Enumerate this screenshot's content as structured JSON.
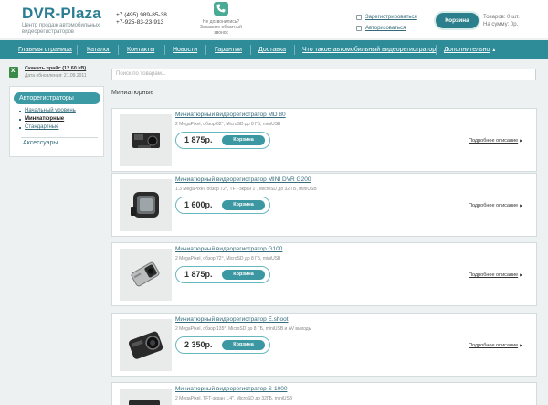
{
  "header": {
    "logo_dvr": "DVR",
    "logo_dash": "-",
    "logo_plaza": "Plaza",
    "logo_sub": "Центр продаж автомобильных видеорегистраторов",
    "phone1": "+7 (495) 989-85-38",
    "phone2": "+7-925-83-23-913",
    "callback_text": "Не дозвонились? Закажите обратный звонок",
    "register_link": "Зарегистрироваться",
    "login_link": "Авторизоваться",
    "cart_label": "Корзина",
    "cart_goods": "Товаров: 0 шт.",
    "cart_sum": "На сумму: 0р."
  },
  "nav": {
    "items": [
      "Главная страница",
      "Каталог",
      "Контакты",
      "Новости",
      "Гарантии",
      "Доставка",
      "Что такое автомобильный видеорегистратор",
      "Дополнительно"
    ]
  },
  "sidebar": {
    "download_label": "Скачать прайс",
    "download_size": "(12.60 kB)",
    "download_date": "Дата обновления: 21.09.2011",
    "active_item": "Авторегистраторы",
    "sub_items": [
      "Начальный уровень",
      "Миниатюрные",
      "Стандартные"
    ],
    "accessories": "Аксессуары"
  },
  "search": {
    "placeholder": "Поиск по товарам..."
  },
  "category_title": "Миниатюрные",
  "card_cart_label": "Корзина",
  "more_label": "Подробное описание",
  "products": [
    {
      "title": "Миниатюрный видеорегистратор MD 80",
      "desc": "2 MegaPixel, обзор 62°, MicroSD до 8 ГБ, miniUSB",
      "price": "1 875р."
    },
    {
      "title": "Миниатюрный видеорегистратор MINI DVR G200",
      "desc": "1.3 MegaPixel, обзор 72°, TFT-экран 1\", MicroSD до 32 ГБ, miniUSB",
      "price": "1 600р."
    },
    {
      "title": "Миниатюрный видеорегистратор G100",
      "desc": "2 MegaPixel, обзор 72°, MicroSD до 8 ГБ, miniUSB",
      "price": "1 875р."
    },
    {
      "title": "Миниатюрный видеорегистратор E.shoot",
      "desc": "2 MegaPixel, обзор 135°, MicroSD до 8 ГБ, miniUSB и AV выходы",
      "price": "2 350р."
    },
    {
      "title": "Миниатюрный видеорегистратор S-1000",
      "desc": "2 MegaPixel, TFT-экран 1.4\", MicroSD до 32ГБ, miniUSB",
      "price": ""
    }
  ]
}
